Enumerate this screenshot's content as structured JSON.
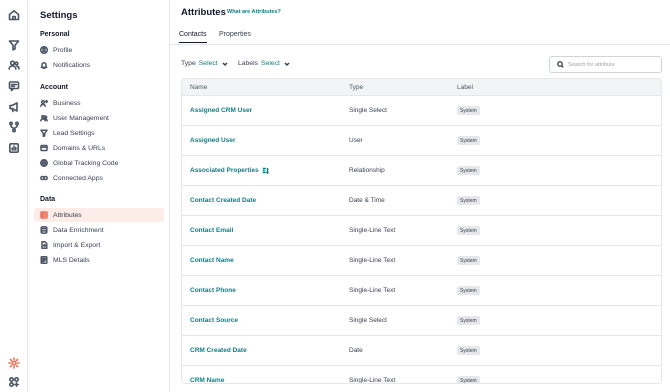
{
  "sidebar": {
    "title": "Settings",
    "sections": [
      {
        "label": "Personal",
        "items": [
          {
            "label": "Profile",
            "icon": "user-circle-icon"
          },
          {
            "label": "Notifications",
            "icon": "bell-icon"
          }
        ]
      },
      {
        "label": "Account",
        "items": [
          {
            "label": "Business",
            "icon": "building-icon"
          },
          {
            "label": "User Management",
            "icon": "users-icon"
          },
          {
            "label": "Lead Settings",
            "icon": "funnel-icon"
          },
          {
            "label": "Domains & URLs",
            "icon": "link-icon"
          },
          {
            "label": "Global Tracking Code",
            "icon": "globe-icon"
          },
          {
            "label": "Connected Apps",
            "icon": "plug-icon"
          }
        ]
      },
      {
        "label": "Data",
        "items": [
          {
            "label": "Attributes",
            "icon": "table-icon",
            "active": true
          },
          {
            "label": "Data Enrichment",
            "icon": "database-icon"
          },
          {
            "label": "Import & Export",
            "icon": "file-import-icon"
          },
          {
            "label": "MLS Details",
            "icon": "mls-icon"
          }
        ]
      }
    ]
  },
  "header": {
    "title": "Attributes",
    "help_link": "What are Attributes?"
  },
  "tabs": [
    {
      "label": "Contacts",
      "active": true
    },
    {
      "label": "Properties",
      "active": false
    }
  ],
  "filters": {
    "type_label": "Type",
    "type_value": "Select",
    "labels_label": "Labels",
    "labels_value": "Select"
  },
  "search": {
    "placeholder": "Search for attribute"
  },
  "table": {
    "columns": [
      "Name",
      "Type",
      "Label"
    ],
    "rows": [
      {
        "name": "Assigned CRM User",
        "type": "Single Select",
        "label": "System"
      },
      {
        "name": "Assigned User",
        "type": "User",
        "label": "System"
      },
      {
        "name": "Associated Properties",
        "type": "Relationship",
        "label": "System"
      },
      {
        "name": "Contact Created Date",
        "type": "Date & Time",
        "label": "System"
      },
      {
        "name": "Contact Email",
        "type": "Single-Line Text",
        "label": "System"
      },
      {
        "name": "Contact Name",
        "type": "Single-Line Text",
        "label": "System"
      },
      {
        "name": "Contact Phone",
        "type": "Single-Line Text",
        "label": "System"
      },
      {
        "name": "Contact Source",
        "type": "Single Select",
        "label": "System"
      },
      {
        "name": "CRM Created Date",
        "type": "Date",
        "label": "System"
      },
      {
        "name": "CRM Name",
        "type": "Single-Line Text",
        "label": "System"
      }
    ]
  },
  "colors": {
    "accent": "#0f7c84",
    "active": "#e8735a",
    "active_bg": "#fdece8"
  }
}
